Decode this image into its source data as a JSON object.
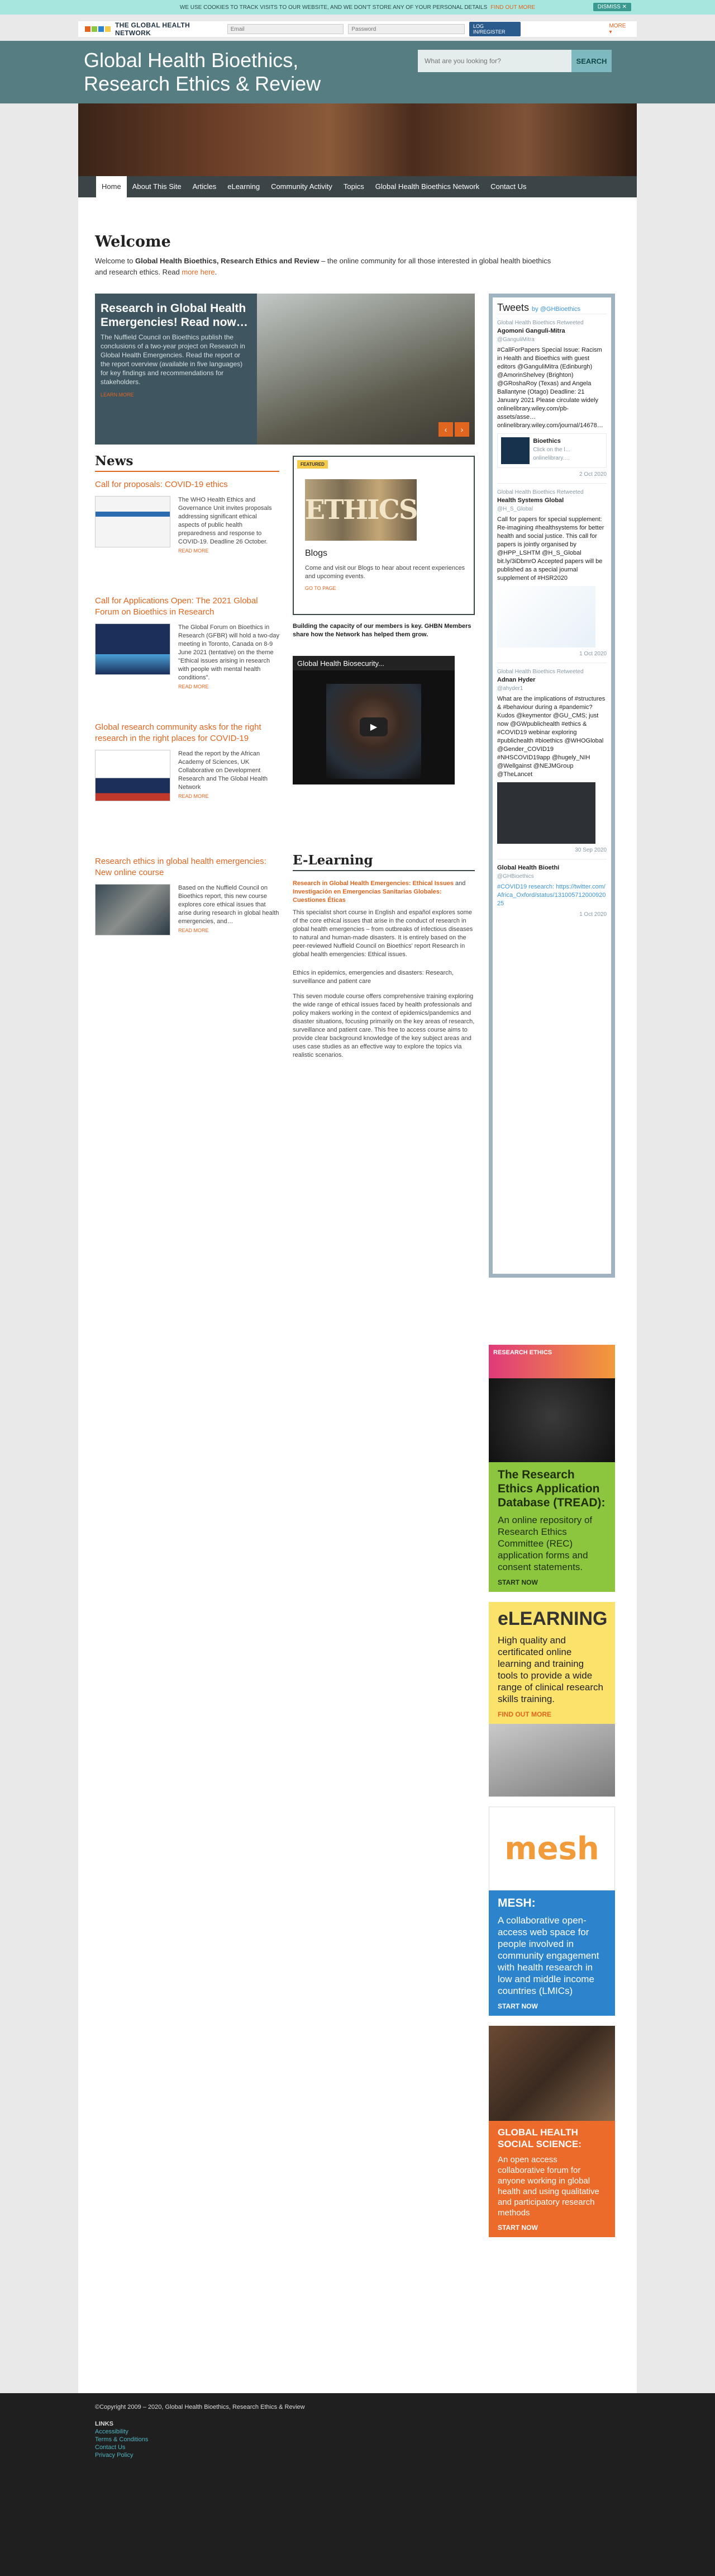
{
  "cookie": {
    "text": "WE USE COOKIES TO TRACK VISITS TO OUR WEBSITE, AND WE DON'T STORE ANY OF YOUR PERSONAL DETAILS",
    "link": "FIND OUT MORE",
    "close": "DISMISS ✕"
  },
  "topbar": {
    "brand": "THE GLOBAL HEALTH NETWORK",
    "email_placeholder": "Email",
    "password_placeholder": "Password",
    "login": "LOG IN/REGISTER",
    "more": "MORE ▾"
  },
  "hero": {
    "title_line1": "Global Health Bioethics,",
    "title_line2": "Research Ethics & Review",
    "search_placeholder": "What are you looking for?",
    "search_button": "SEARCH"
  },
  "nav": [
    "Home",
    "About This Site",
    "Articles",
    "eLearning",
    "Community Activity",
    "Topics",
    "Global Health Bioethics Network",
    "Contact Us"
  ],
  "welcome": {
    "title": "Welcome",
    "pre": "Welcome to ",
    "site": "Global Health Bioethics, Research Ethics and Review",
    "post": " – the online community for all those interested in global health bioethics and research ethics. Read ",
    "more": "more here",
    "end": "."
  },
  "slider": {
    "title": "Research in Global Health Emergencies! Read now…",
    "text": "The Nuffield Council on Bioethics publish the conclusions of a two-year project on Research in Global Health Emergencies. Read the report or the report overview (available in five languages) for key findings and recommendations for stakeholders.",
    "link": "LEARN MORE",
    "prev": "‹",
    "next": "›"
  },
  "news": {
    "heading": "News",
    "items": [
      {
        "title": "Call for proposals: COVID-19 ethics",
        "text": "The WHO Health Ethics and Governance Unit invites proposals addressing significant ethical aspects of public health preparedness and response to COVID-19. Deadline 26 October.",
        "more": "READ MORE"
      },
      {
        "title": "Call for Applications Open: The 2021 Global Forum on Bioethics in Research",
        "text": "The Global Forum on Bioethics in Research (GFBR) will hold a two-day meeting in Toronto, Canada on 8-9 June 2021 (tentative) on the theme \"Ethical issues arising in research with people with mental health conditions\".",
        "more": "READ MORE"
      },
      {
        "title": "Global research community asks for the right research in the right places for COVID-19",
        "text": "Read the report by the African Academy of Sciences, UK Collaborative on Development Research and The Global Health Network",
        "more": "READ MORE"
      },
      {
        "title": "Research ethics in global health emergencies: New online course",
        "text": "Based on the Nuffield Council on Bioethics report, this new course explores core ethical issues that arise during research in global health emergencies, and…",
        "more": "READ MORE"
      }
    ]
  },
  "blogs": {
    "featured": "FEATURED",
    "image_word": "ETHICS",
    "title": "Blogs",
    "text": "Come and visit our Blogs to hear about recent experiences and upcoming events.",
    "link": "GO TO PAGE"
  },
  "capacity": "Building the capacity of our members is key. GHBN Members share how the Network has helped them grow.",
  "video": {
    "title": "Global Health Biosecurity...",
    "play": "▶"
  },
  "elearning": {
    "heading": "E-Learning",
    "course1_title": "Research in Global Health Emergencies: Ethical Issues",
    "course1_and": " and ",
    "course1_title_es": "Investigación en Emergencias Sanitarias Globales: Cuestiones Éticas",
    "course1_text": "This specialist short course in English and español explores some of the core ethical issues that arise in the conduct of research in global health emergencies – from outbreaks of infectious diseases to natural and human-made disasters. It is entirely based on the peer-reviewed Nuffield Council on Bioethics' report Research in global health emergencies: Ethical issues.",
    "course2_title": "Ethics in epidemics, emergencies and disasters: Research, surveillance and patient care",
    "course2_text": "This seven module course offers comprehensive training exploring the wide range of ethical issues faced by health professionals and policy makers working in the context of epidemics/pandemics and disaster situations, focusing primarily on the key areas of research, surveillance and patient care. This free to access course aims to provide clear background knowledge of the key subject areas and uses case studies as an effective way to explore the topics via realistic scenarios."
  },
  "tweets": {
    "title": "Tweets",
    "by": "by @GHBioethics",
    "items": [
      {
        "rt": "Global Health Bioethics Retweeted",
        "name": "Agomoni Ganguli-Mitra",
        "handle": "@GanguliMitra",
        "text": "#CallForPapers Special Issue: Racism in Health and Bioethics with guest editors @GanguliMitra (Edinburgh) @AmorinShelvey (Brighton) @GRoshaRoy (Texas) and Angela Ballantyne (Otago) Deadline: 21 January 2021 Please circulate widely onlinelibrary.wiley.com/pb-assets/asse… onlinelibrary.wiley.com/journal/14678…",
        "media": "Bioethics",
        "media_sub": "Click on the l… onlinelibrary.…",
        "date": "2 Oct 2020"
      },
      {
        "rt": "Global Health Bioethics Retweeted",
        "name": "Health Systems Global",
        "handle": "@H_S_Global",
        "text": "Call for papers for special supplement: Re-imagining #healthsystems for better health and social justice. This call for papers is jointly organised by @HPP_LSHTM @H_S_Global bit.ly/3iDbmrO Accepted papers will be published as a special journal supplement of #HSR2020",
        "date": "1 Oct 2020"
      },
      {
        "rt": "Global Health Bioethics Retweeted",
        "name": "Adnan Hyder",
        "handle": "@ahyder1",
        "text": "What are the implications of #structures & #behaviour during a #pandemic? Kudos @keymentor @GU_CMS; just now @GWpublichealth #ethics & #COVID19 webinar exploring #publichealth #bioethics @WHOGlobal @Gender_COVID19 #NHSCOVID19app @hugely_NIH @Wellgainst @NEJMGroup @TheLancet",
        "date": "30 Sep 2020"
      },
      {
        "rt": "",
        "name": "Global Health Bioethi",
        "handle": "@GHBioethics",
        "text": "#COVID19 research: https://twitter.com/Africa_Oxford/status/13100571200092025",
        "date": "1 Oct 2020"
      }
    ]
  },
  "ads": [
    {
      "name": "tread",
      "top": "RESEARCH ETHICS",
      "title": "The Research Ethics Application Database (TREAD):",
      "text": "An online repository of Research Ethics Committee (REC) application forms and consent statements.",
      "cta": "START NOW",
      "bg": "#8cc63f",
      "fg": "#1f2f0c"
    },
    {
      "name": "elearning",
      "top": "",
      "title": "eLEARNING",
      "text": "High quality and certificated online learning and training tools to provide a wide range of clinical research skills training.",
      "cta": "FIND OUT MORE",
      "bg": "#fbe26b",
      "fg": "#222222"
    },
    {
      "name": "mesh",
      "top": "mesh",
      "title": "MESH:",
      "text": "A collaborative open-access web space for people involved in community engagement with health research in low and middle income countries (LMICs)",
      "cta": "START NOW",
      "bg": "#2c85cc",
      "fg": "#ffffff"
    },
    {
      "name": "ghss",
      "top": "",
      "title": "GLOBAL HEALTH SOCIAL SCIENCE:",
      "text": "An open access collaborative forum for anyone working in global health and using qualitative and participatory research methods",
      "cta": "START NOW",
      "bg": "#ec6a2a",
      "fg": "#ffffff"
    }
  ],
  "footer": {
    "copyright": "©Copyright 2009 – 2020, Global Health Bioethics, Research Ethics & Review",
    "links_heading": "LINKS",
    "links": [
      "Accessibility",
      "Terms & Conditions",
      "Contact Us",
      "Privacy Policy"
    ]
  }
}
